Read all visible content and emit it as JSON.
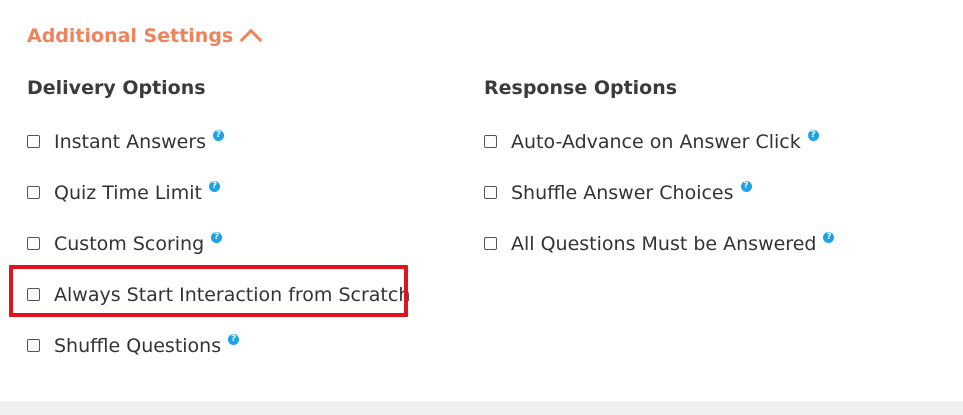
{
  "additional_settings": {
    "toggle_label": "Additional Settings",
    "expanded": true
  },
  "delivery_options": {
    "heading": "Delivery Options",
    "items": [
      {
        "label": "Instant Answers",
        "checked": false,
        "has_help": true,
        "help_glyph": "?"
      },
      {
        "label": "Quiz Time Limit",
        "checked": false,
        "has_help": true,
        "help_glyph": "?"
      },
      {
        "label": "Custom Scoring",
        "checked": false,
        "has_help": true,
        "help_glyph": "?"
      },
      {
        "label": "Always Start Interaction from Scratch",
        "checked": false,
        "has_help": false,
        "highlighted": true
      },
      {
        "label": "Shuffle Questions",
        "checked": false,
        "has_help": true,
        "help_glyph": "?"
      }
    ]
  },
  "response_options": {
    "heading": "Response Options",
    "items": [
      {
        "label": "Auto-Advance on Answer Click",
        "checked": false,
        "has_help": true,
        "help_glyph": "?"
      },
      {
        "label": "Shuffle Answer Choices",
        "checked": false,
        "has_help": true,
        "help_glyph": "?"
      },
      {
        "label": "All Questions Must be Answered",
        "checked": false,
        "has_help": true,
        "help_glyph": "?"
      }
    ]
  },
  "colors": {
    "accent": "#f2825a",
    "help_icon": "#1aa3e8",
    "highlight_border": "#e0141e",
    "text": "#333333"
  },
  "icons": {
    "toggle": "chevron-up-icon",
    "help": "question-circle-icon",
    "checkbox": "checkbox-unchecked-icon"
  }
}
